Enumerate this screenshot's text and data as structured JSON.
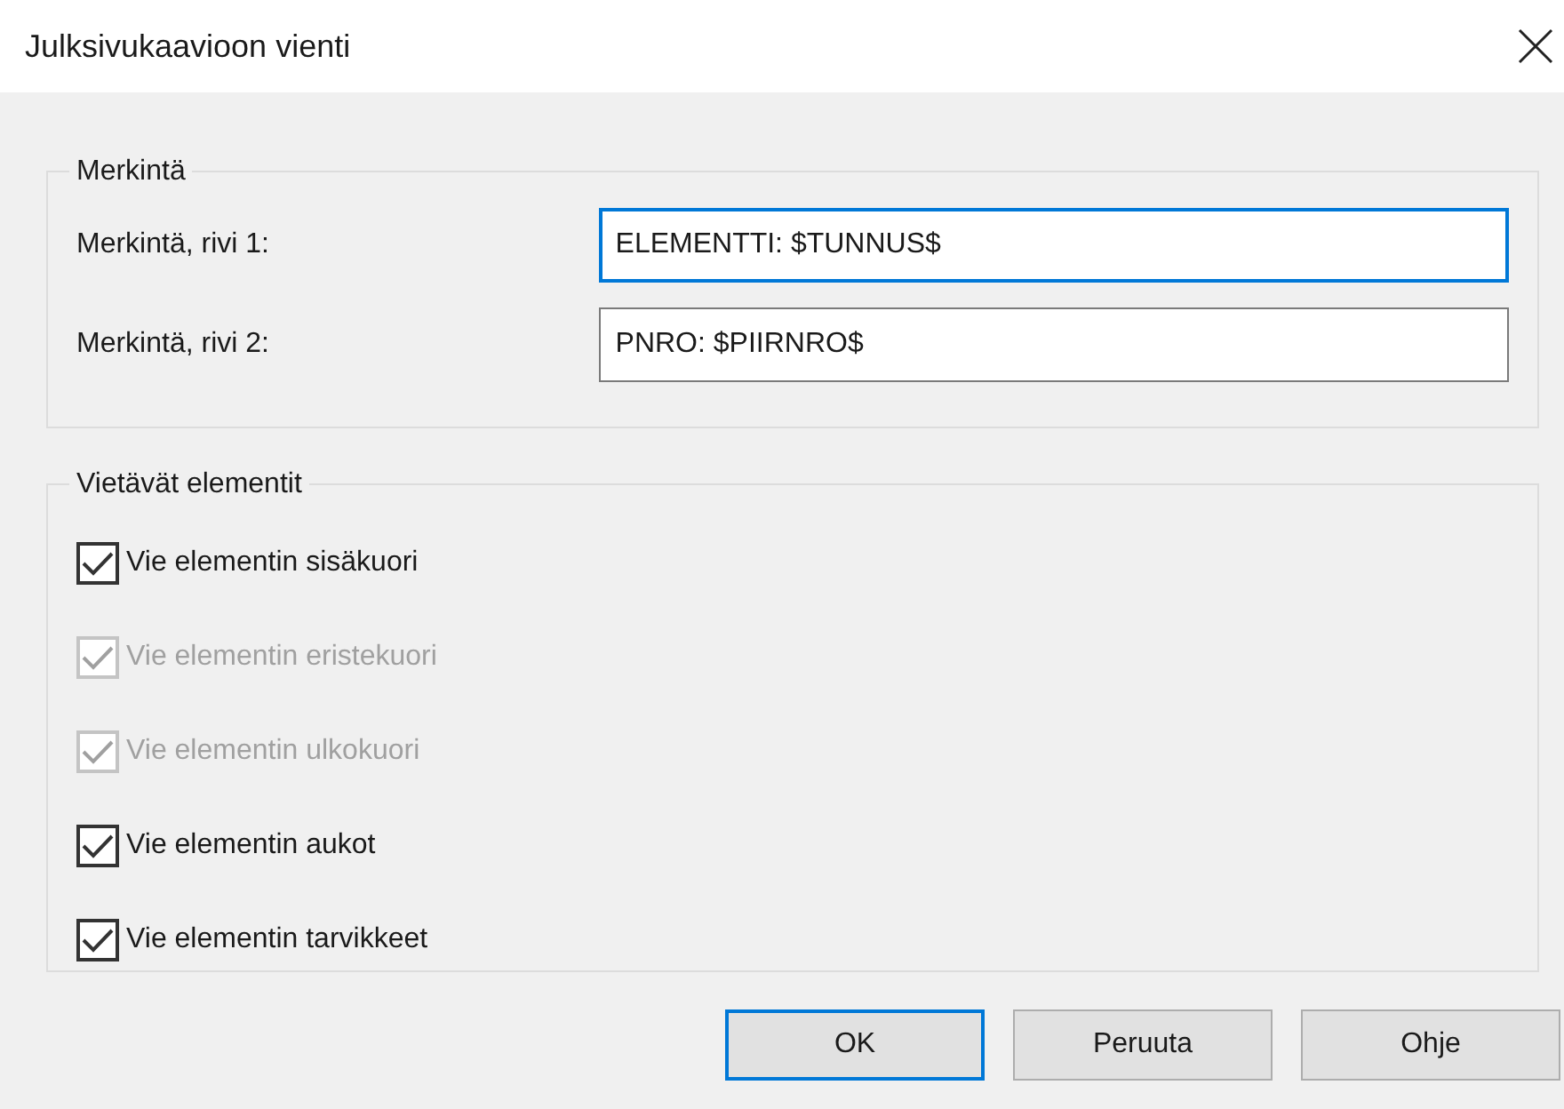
{
  "window": {
    "title": "Julksivukaavioon vienti"
  },
  "label_group": {
    "title": "Merkintä",
    "fields": [
      {
        "label": "Merkintä, rivi 1:",
        "value": "ELEMENTTI: $TUNNUS$",
        "focused": true
      },
      {
        "label": "Merkintä, rivi 2:",
        "value": "PNRO: $PIIRNRO$",
        "focused": false
      }
    ]
  },
  "export_group": {
    "title": "Vietävät elementit",
    "checkboxes": [
      {
        "label": "Vie elementin sisäkuori",
        "checked": true,
        "disabled": false
      },
      {
        "label": "Vie elementin eristekuori",
        "checked": true,
        "disabled": true
      },
      {
        "label": "Vie elementin ulkokuori",
        "checked": true,
        "disabled": true
      },
      {
        "label": "Vie elementin aukot",
        "checked": true,
        "disabled": false
      },
      {
        "label": "Vie elementin tarvikkeet",
        "checked": true,
        "disabled": false
      }
    ]
  },
  "buttons": [
    {
      "label": "OK",
      "default": true
    },
    {
      "label": "Peruuta",
      "default": false
    },
    {
      "label": "Ohje",
      "default": false
    }
  ]
}
